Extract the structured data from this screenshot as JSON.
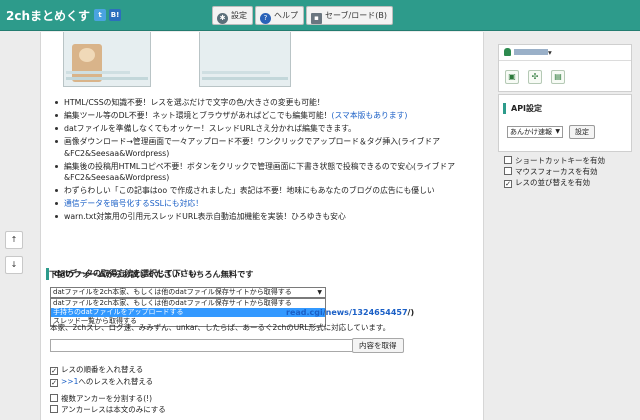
{
  "header": {
    "logo": "2chまとめくす",
    "twitter": "t",
    "hatena": "B!",
    "settings_label": "設定",
    "help_label": "ヘルプ",
    "saveload_label": "セーブ/ロード(B)"
  },
  "side": {
    "up": "↑",
    "down": "↓"
  },
  "features": [
    "HTML/CSSの知識不要！レスを選ぶだけで文字の色/大きさの変更も可能！",
    "編集ツール等のDL不要！ネット環境とブラウザがあればどこでも編集可能！",
    "datファイルを準備しなくてもオッケー！スレッドURLさえ分かれば編集できます。",
    "画像ダウンロード→管理画面で一々アップロード不要！ワンクリックでアップロード＆タグ挿入(ライブドア",
    "&FC2&Seesaa&Wordpress)",
    "編集後の投稿用HTMLコピペ不要！ボタンをクリックで管理画面に下書き状態で投稿できるので安心(ライブドア",
    "&FC2&Seesaa&Wordpress)",
    "わずらわしい「この記事はoo で作成されました」表記は不要！地味にもあなたのブログの広告にも優しい",
    "通信データを暗号化するSSLにも対応！",
    "warn.txt対策用の引用元スレッドURL表示自動追加機能を実装！ひろゆきも安心"
  ],
  "feature_suffix": "(スマ本版もあります)",
  "intro": "下記のフォームからお試しください！もちろん無料です",
  "form": {
    "section_title": "datデータの取得方法を選択して下さい",
    "select_value": "datファイルを2ch本家、もしくは他のdatファイル保存サイトから取得する",
    "options": [
      "datファイルを2ch本家、もしくは他のdatファイル保存サイトから取得する",
      "手持ちのdatファイルをアップロードする",
      "スレッド一覧から取得する"
    ],
    "url_example_prefix": "read.cgi/news/1324654457",
    "url_example_suffix": "/)",
    "note": "本家、2chスレ、ログ速、みみずん、unkar、したらば、あーるぐ2chのURL形式に対応しています。",
    "url_value": "",
    "fetch_button": "内容を取得",
    "check1": "レスの順番を入れ替える",
    "check2_blue": ">>1",
    "check2": "へのレスを入れ替える",
    "check3": "複数アンカーを分割する(!)",
    "check4": "アンカーレスは本文のみにする"
  },
  "sidebar": {
    "user_caret": "▾",
    "icons": [
      "▣",
      "✣",
      "▤"
    ],
    "api_title": "API設定",
    "api_select": "あんかけ速報",
    "api_button": "設定",
    "option1": "ショートカットキーを有効",
    "option2": "マウスフォーカスを有効",
    "option3": "レスの並び替えを有効"
  }
}
